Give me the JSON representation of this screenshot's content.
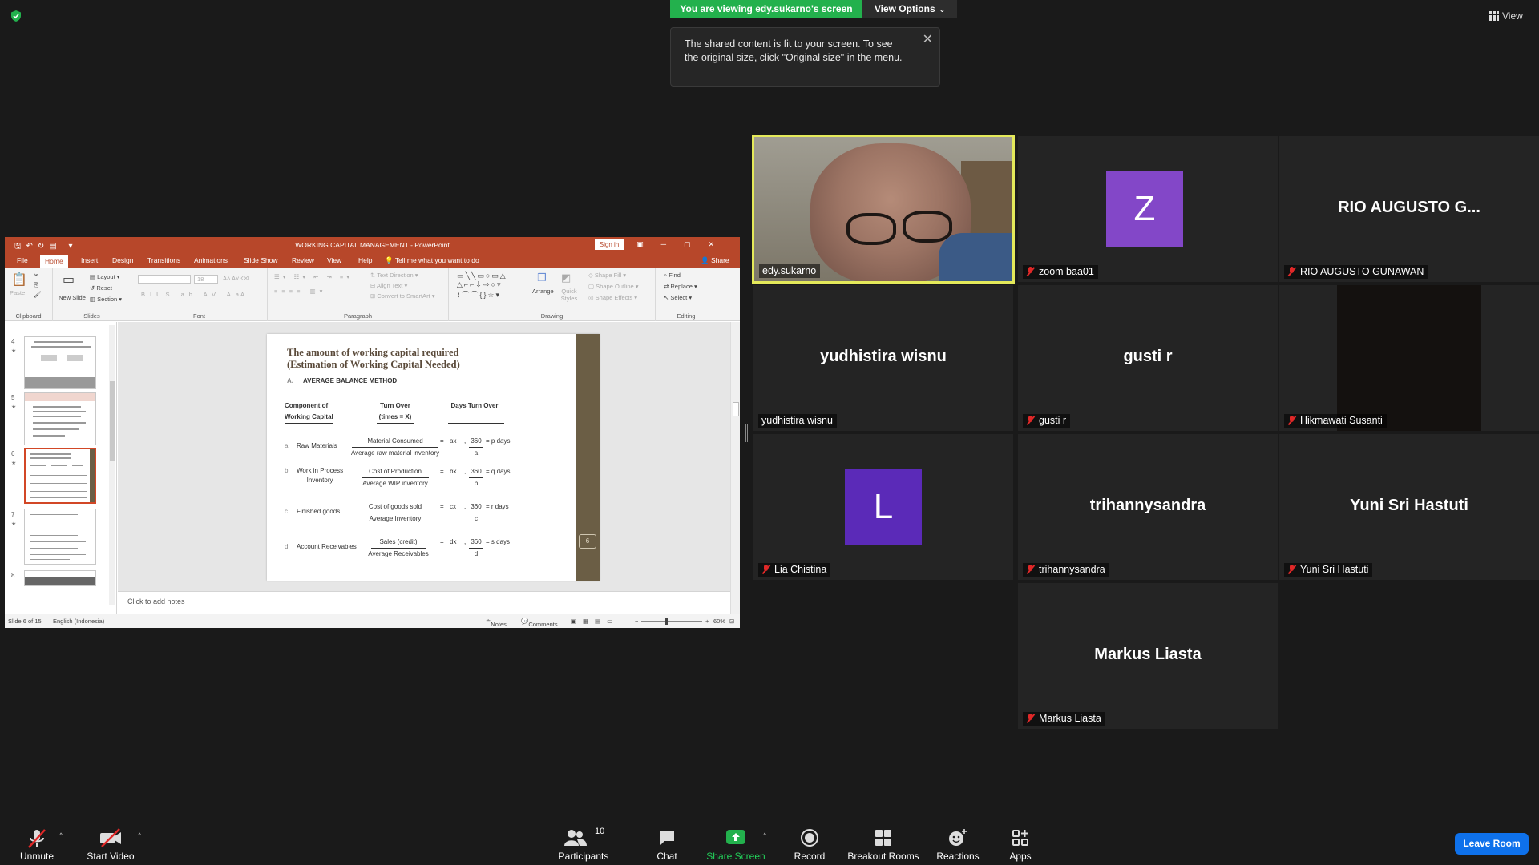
{
  "top": {
    "viewing_banner": "You are viewing edy.sukarno's screen",
    "view_options": "View Options",
    "tooltip": "The shared content is fit to your screen. To see the original size, click \"Original size\" in the menu.",
    "view_label": "View"
  },
  "ppt": {
    "title": "WORKING CAPITAL MANAGEMENT  -  PowerPoint",
    "sign_in": "Sign in",
    "tabs": [
      "File",
      "Home",
      "Insert",
      "Design",
      "Transitions",
      "Animations",
      "Slide Show",
      "Review",
      "View",
      "Help"
    ],
    "tell_me": "Tell me what you want to do",
    "share": "Share",
    "ribbon": {
      "paste": "Paste",
      "clipboard": "Clipboard",
      "new_slide": "New Slide",
      "layout": "Layout",
      "reset": "Reset",
      "section": "Section",
      "slides": "Slides",
      "font_size": "18",
      "font": "Font",
      "text_direction": "Text Direction",
      "align_text": "Align Text",
      "convert_smartart": "Convert to SmartArt",
      "paragraph": "Paragraph",
      "arrange": "Arrange",
      "quick_styles": "Quick Styles",
      "shape_fill": "Shape Fill",
      "shape_outline": "Shape Outline",
      "shape_effects": "Shape Effects",
      "drawing": "Drawing",
      "find": "Find",
      "replace": "Replace",
      "select": "Select",
      "editing": "Editing"
    },
    "thumb_numbers": [
      "4",
      "5",
      "6",
      "7",
      "8"
    ],
    "slide": {
      "title": "The amount of working capital required\n(Estimation of Working Capital Needed)",
      "subtitle_letter": "A.",
      "subtitle": "AVERAGE BALANCE METHOD",
      "col1": "Component of\nWorking Capital",
      "col2": "Turn Over\n(times = X)",
      "col3": "Days Turn Over",
      "rows": [
        {
          "letter": "a.",
          "label": "Raw Materials",
          "num": "Material Consumed",
          "den": "Average raw material inventory",
          "x": "ax",
          "days_num": "360",
          "days_den": "a",
          "result": "= p days"
        },
        {
          "letter": "b.",
          "label": "Work in Process\nInventory",
          "num": "Cost of Production",
          "den": "Average WIP inventory",
          "x": "bx",
          "days_num": "360",
          "days_den": "b",
          "result": "= q days"
        },
        {
          "letter": "c.",
          "label": "Finished goods",
          "num": "Cost of goods sold",
          "den": "Average Inventory",
          "x": "cx",
          "days_num": "360",
          "days_den": "c",
          "result": "= r days"
        },
        {
          "letter": "d.",
          "label": "Account Receivables",
          "num": "Sales (credit)",
          "den": "Average Receivables",
          "x": "dx",
          "days_num": "360",
          "days_den": "d",
          "result": "= s days"
        }
      ],
      "page_number": "6"
    },
    "notes_placeholder": "Click to add notes",
    "status": {
      "slide_of": "Slide 6 of 15",
      "language": "English (Indonesia)",
      "notes": "Notes",
      "comments": "Comments",
      "zoom": "60%"
    }
  },
  "participants": [
    {
      "name": "edy.sukarno",
      "display": "",
      "muted": false
    },
    {
      "name": "zoom baa01",
      "avatar": "Z",
      "avatar_color": "#8347c8",
      "muted": true
    },
    {
      "name": "RIO AUGUSTO GUNAWAN",
      "display": "RIO AUGUSTO G...",
      "muted": true
    },
    {
      "name": "yudhistira wisnu",
      "display": "yudhistira wisnu",
      "muted": false
    },
    {
      "name": "gusti r",
      "display": "gusti r",
      "muted": true
    },
    {
      "name": "Hikmawati Susanti",
      "display": "",
      "muted": true
    },
    {
      "name": "Lia Chistina",
      "avatar": "L",
      "avatar_color": "#5b2ab8",
      "muted": true
    },
    {
      "name": "trihannysandra",
      "display": "trihannysandra",
      "muted": true
    },
    {
      "name": "Yuni Sri Hastuti",
      "display": "Yuni Sri Hastuti",
      "muted": true
    },
    {
      "name": "Markus Liasta",
      "display": "Markus Liasta",
      "muted": true
    }
  ],
  "toolbar": {
    "unmute": "Unmute",
    "start_video": "Start Video",
    "participants": "Participants",
    "participants_count": "10",
    "chat": "Chat",
    "share_screen": "Share Screen",
    "record": "Record",
    "breakout_rooms": "Breakout Rooms",
    "reactions": "Reactions",
    "apps": "Apps",
    "leave_room": "Leave Room"
  },
  "colors": {
    "ppt_accent": "#b7472a",
    "zoom_green": "#23b14d",
    "leave_blue": "#0e71eb",
    "active_speaker": "#e4e95a",
    "muted_red": "#e02828"
  }
}
